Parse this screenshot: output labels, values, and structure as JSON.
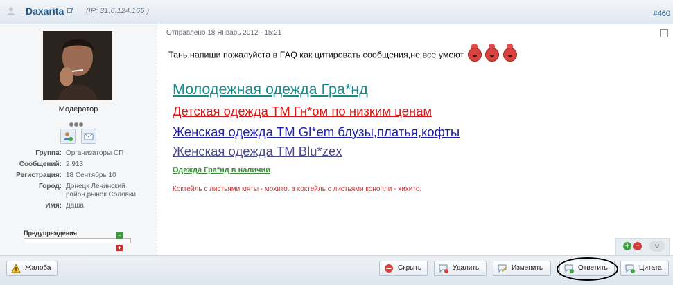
{
  "header": {
    "author": "Daxarita",
    "ip": "(IP: 31.6.124.165 )",
    "post_number": "#460"
  },
  "user": {
    "role": "Модератор",
    "info": [
      {
        "key": "Группа:",
        "value": "Организаторы СП"
      },
      {
        "key": "Сообщений:",
        "value": "2 913"
      },
      {
        "key": "Регистрация:",
        "value": "18 Сентябрь 10"
      },
      {
        "key": "Город:",
        "value": "Донецк Ленинский район,рынок Соловки"
      },
      {
        "key": "Имя:",
        "value": "Даша"
      }
    ],
    "warnings_label": "Предупреждения"
  },
  "post": {
    "date": "Отправлено 18 Январь 2012 - 15:21",
    "message": "Тань,напиши пожалуйста в FAQ как цитировать сообщения,не все умеют",
    "signature": [
      "Молодежная одежда Гра*нд",
      "Детская одежда ТМ Гн*ом по низким ценам",
      "Женская одежда ТМ Gl*em блузы,платья,кофты",
      "Женская одежда ТМ Blu*zex ",
      "Одежда Гра*нд в наличии",
      "Коктейль с листьями мяты - мохито. а коктейль с листьями конопли - хихито."
    ],
    "rating": "0"
  },
  "actions": {
    "report": "Жалоба",
    "hide": "Скрыть",
    "delete": "Удалить",
    "edit": "Изменить",
    "reply": "Ответить",
    "quote": "Цитата"
  },
  "colors": {
    "link": "#215a8c",
    "sig_teal": "#148c8c",
    "sig_red": "#e01515",
    "sig_blue": "#2020b0"
  }
}
